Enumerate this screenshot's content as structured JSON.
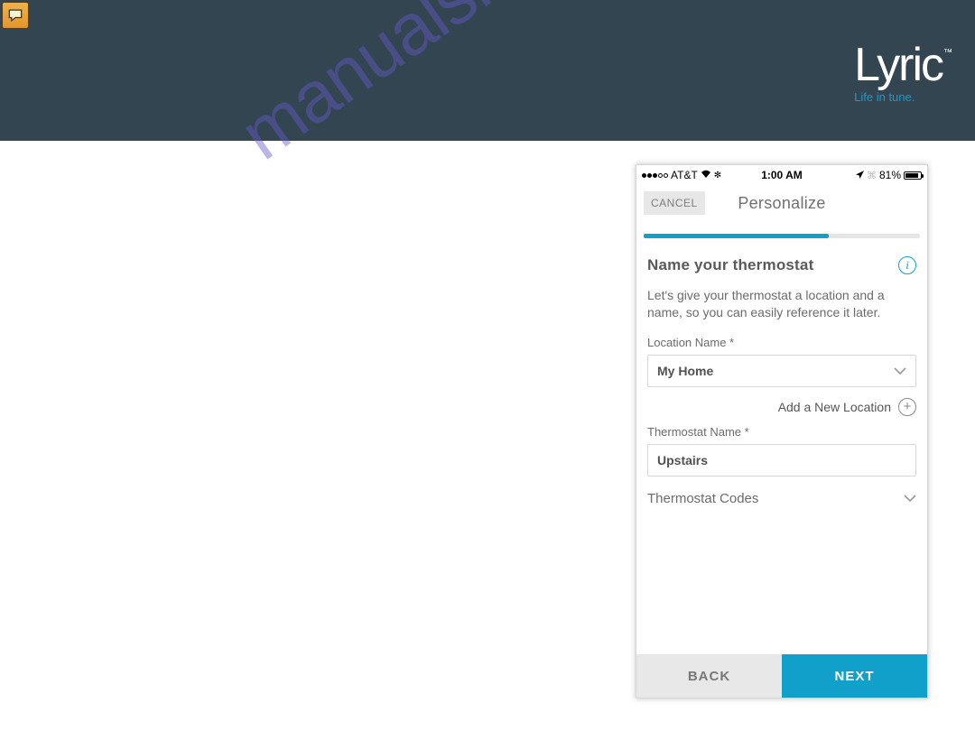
{
  "brand": {
    "name": "Lyric",
    "tagline": "Life in tune.",
    "trademark": "™"
  },
  "watermark": "manualshive.com",
  "phone": {
    "status": {
      "carrier": "AT&T",
      "time": "1:00 AM",
      "battery_pct": "81%"
    },
    "nav": {
      "cancel": "CANCEL",
      "title": "Personalize"
    },
    "progress_pct": 67,
    "section_title": "Name your thermostat",
    "intro": "Let's give your thermostat a location and a name, so you can easily reference it later.",
    "location": {
      "label": "Location Name *",
      "value": "My Home",
      "add_label": "Add a New Location"
    },
    "thermostat": {
      "label": "Thermostat Name *",
      "value": "Upstairs"
    },
    "codes_label": "Thermostat Codes",
    "footer": {
      "back": "BACK",
      "next": "NEXT"
    }
  }
}
